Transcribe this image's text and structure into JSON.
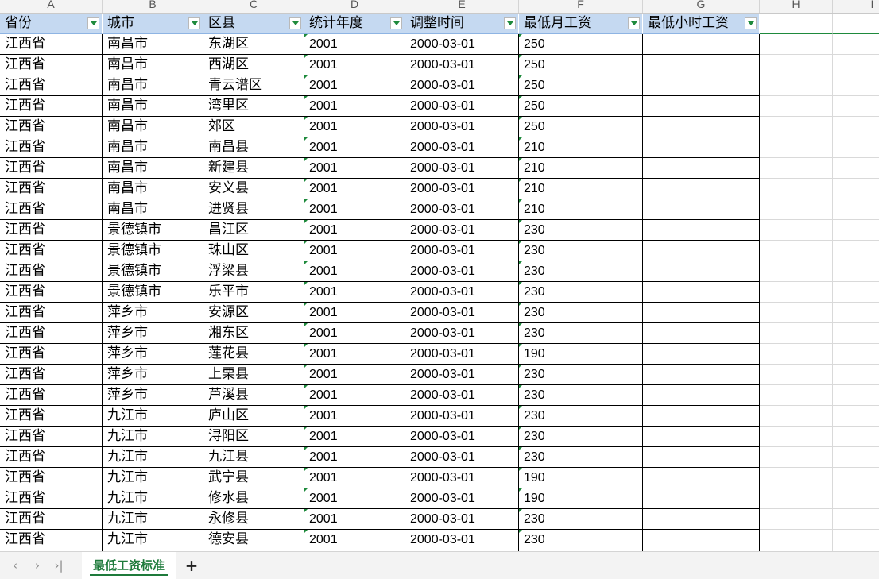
{
  "columns": [
    "A",
    "B",
    "C",
    "D",
    "E",
    "F",
    "G",
    "H",
    "I"
  ],
  "table": {
    "headers": [
      "省份",
      "城市",
      "区县",
      "统计年度",
      "调整时间",
      "最低月工资",
      "最低小时工资"
    ],
    "rows": [
      [
        "江西省",
        "南昌市",
        "东湖区",
        "2001",
        "2000-03-01",
        "250",
        ""
      ],
      [
        "江西省",
        "南昌市",
        "西湖区",
        "2001",
        "2000-03-01",
        "250",
        ""
      ],
      [
        "江西省",
        "南昌市",
        "青云谱区",
        "2001",
        "2000-03-01",
        "250",
        ""
      ],
      [
        "江西省",
        "南昌市",
        "湾里区",
        "2001",
        "2000-03-01",
        "250",
        ""
      ],
      [
        "江西省",
        "南昌市",
        "郊区",
        "2001",
        "2000-03-01",
        "250",
        ""
      ],
      [
        "江西省",
        "南昌市",
        "南昌县",
        "2001",
        "2000-03-01",
        "210",
        ""
      ],
      [
        "江西省",
        "南昌市",
        "新建县",
        "2001",
        "2000-03-01",
        "210",
        ""
      ],
      [
        "江西省",
        "南昌市",
        "安义县",
        "2001",
        "2000-03-01",
        "210",
        ""
      ],
      [
        "江西省",
        "南昌市",
        "进贤县",
        "2001",
        "2000-03-01",
        "210",
        ""
      ],
      [
        "江西省",
        "景德镇市",
        "昌江区",
        "2001",
        "2000-03-01",
        "230",
        ""
      ],
      [
        "江西省",
        "景德镇市",
        "珠山区",
        "2001",
        "2000-03-01",
        "230",
        ""
      ],
      [
        "江西省",
        "景德镇市",
        "浮梁县",
        "2001",
        "2000-03-01",
        "230",
        ""
      ],
      [
        "江西省",
        "景德镇市",
        "乐平市",
        "2001",
        "2000-03-01",
        "230",
        ""
      ],
      [
        "江西省",
        "萍乡市",
        "安源区",
        "2001",
        "2000-03-01",
        "230",
        ""
      ],
      [
        "江西省",
        "萍乡市",
        "湘东区",
        "2001",
        "2000-03-01",
        "230",
        ""
      ],
      [
        "江西省",
        "萍乡市",
        "莲花县",
        "2001",
        "2000-03-01",
        "190",
        ""
      ],
      [
        "江西省",
        "萍乡市",
        "上栗县",
        "2001",
        "2000-03-01",
        "230",
        ""
      ],
      [
        "江西省",
        "萍乡市",
        "芦溪县",
        "2001",
        "2000-03-01",
        "230",
        ""
      ],
      [
        "江西省",
        "九江市",
        "庐山区",
        "2001",
        "2000-03-01",
        "230",
        ""
      ],
      [
        "江西省",
        "九江市",
        "浔阳区",
        "2001",
        "2000-03-01",
        "230",
        ""
      ],
      [
        "江西省",
        "九江市",
        "九江县",
        "2001",
        "2000-03-01",
        "230",
        ""
      ],
      [
        "江西省",
        "九江市",
        "武宁县",
        "2001",
        "2000-03-01",
        "190",
        ""
      ],
      [
        "江西省",
        "九江市",
        "修水县",
        "2001",
        "2000-03-01",
        "190",
        ""
      ],
      [
        "江西省",
        "九江市",
        "永修县",
        "2001",
        "2000-03-01",
        "230",
        ""
      ],
      [
        "江西省",
        "九江市",
        "德安县",
        "2001",
        "2000-03-01",
        "230",
        ""
      ]
    ]
  },
  "tabbar": {
    "prev_icon": "chevron-left-icon",
    "next_icon": "chevron-right-icon",
    "last_icon": "chevron-last-icon",
    "active_sheet": "最低工资标准",
    "add_icon": "plus-icon"
  },
  "colors": {
    "header_fill": "#c5d9f1",
    "accent_green": "#1e7a3b"
  }
}
